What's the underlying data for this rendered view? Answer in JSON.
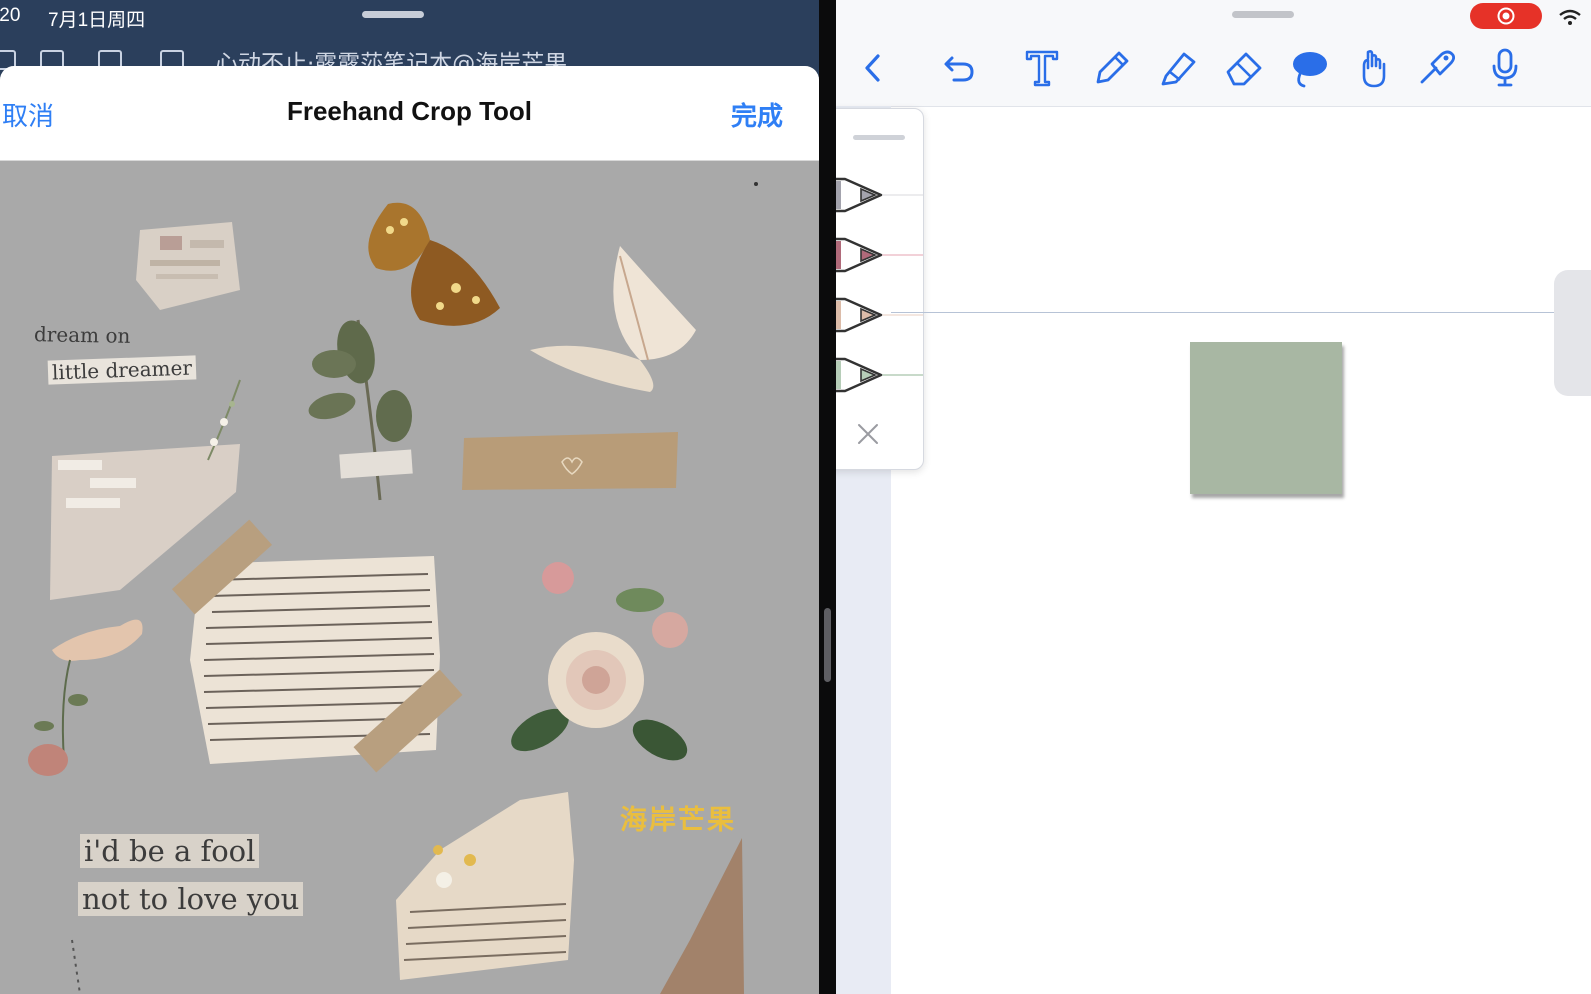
{
  "status_bar": {
    "time": ":20",
    "date": "7月1日周四"
  },
  "background_toolbar": {
    "title": "心动不止·露露莎笔记本@海岸芒果"
  },
  "crop_sheet": {
    "cancel_label": "取消",
    "title": "Freehand Crop Tool",
    "done_label": "完成"
  },
  "collage": {
    "caption_dream": "dream on",
    "caption_little": "little dreamer",
    "caption_fool": "i'd be a fool",
    "caption_love": "not to love you",
    "watermark": "海岸芒果"
  },
  "colors": {
    "accent_blue": "#2f7ff5",
    "toolbar_icon": "#2a6ee8",
    "record_red": "#e63228",
    "sticky_note": "#a8b7a3",
    "sheet_bg": "#a9a9a9"
  },
  "note_toolbar": {
    "tools": [
      "back-icon",
      "undo-icon",
      "text-icon",
      "pen-icon",
      "highlighter-icon",
      "eraser-icon",
      "lasso-icon",
      "hand-gesture-icon",
      "laser-pointer-icon",
      "microphone-icon"
    ]
  },
  "pen_palette": {
    "pens": [
      {
        "name": "pen-gray",
        "color": "#a3a3ad"
      },
      {
        "name": "pen-rose",
        "color": "#b06a7a"
      },
      {
        "name": "pen-peach",
        "color": "#dcbca9"
      },
      {
        "name": "pen-sage",
        "color": "#b6cdb8"
      }
    ]
  }
}
